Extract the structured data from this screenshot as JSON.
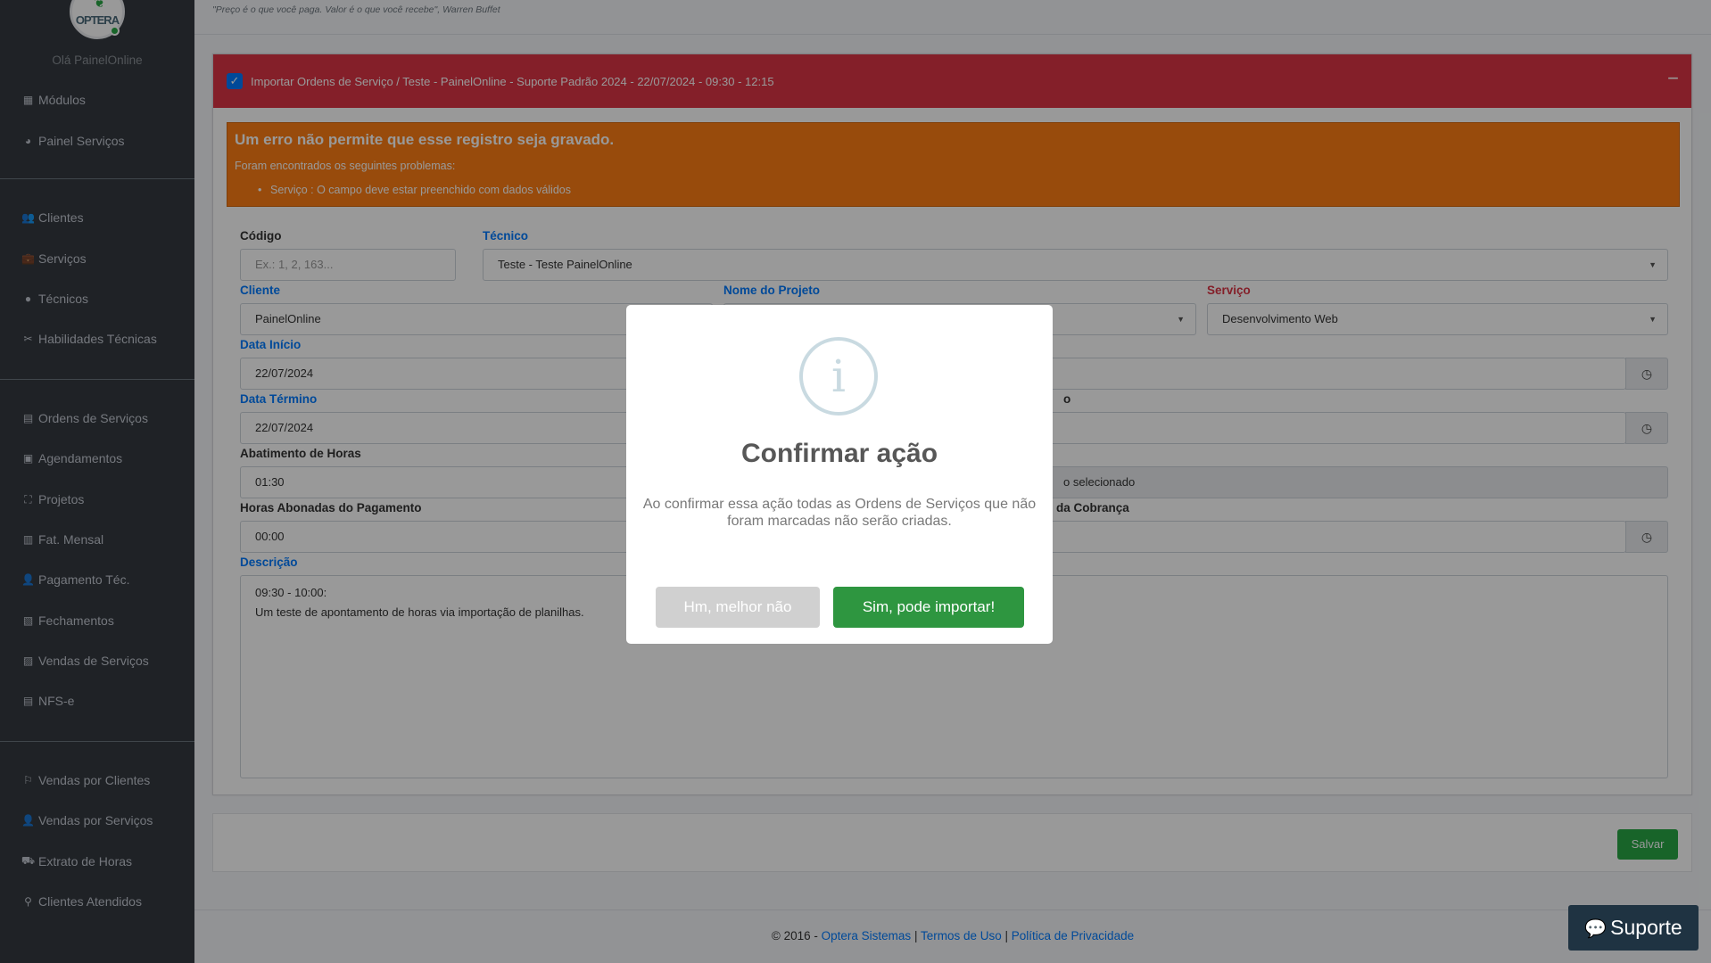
{
  "sidebar": {
    "greeting": "Olá PainelOnline",
    "logo_text": "OPTERA",
    "groups": [
      [
        {
          "label": "Módulos",
          "icon": "▦"
        },
        {
          "label": "Painel Serviços",
          "icon": "◕"
        }
      ],
      [
        {
          "label": "Clientes",
          "icon": "👥"
        },
        {
          "label": "Serviços",
          "icon": "💼"
        },
        {
          "label": "Técnicos",
          "icon": "●"
        },
        {
          "label": "Habilidades Técnicas",
          "icon": "✂"
        }
      ],
      [
        {
          "label": "Ordens de Serviços",
          "icon": "▤"
        },
        {
          "label": "Agendamentos",
          "icon": "▣"
        },
        {
          "label": "Projetos",
          "icon": "⛶"
        },
        {
          "label": "Fat. Mensal",
          "icon": "▥"
        },
        {
          "label": "Pagamento Téc.",
          "icon": "👤"
        },
        {
          "label": "Fechamentos",
          "icon": "▧"
        },
        {
          "label": "Vendas de Serviços",
          "icon": "▨"
        },
        {
          "label": "NFS-e",
          "icon": "▤"
        }
      ],
      [
        {
          "label": "Vendas por Clientes",
          "icon": "⚐"
        },
        {
          "label": "Vendas por Serviços",
          "icon": "👤"
        },
        {
          "label": "Extrato de Horas",
          "icon": "⛟"
        },
        {
          "label": "Clientes Atendidos",
          "icon": "⚲"
        }
      ]
    ]
  },
  "header": {
    "quote": "\"Preço é o que você paga. Valor é o que você recebe\", Warren Buffet"
  },
  "card": {
    "title": "Importar Ordens de Serviço / Teste - PainelOnline - Suporte Padrão 2024 - 22/07/2024 - 09:30 - 12:15",
    "alert": {
      "heading": "Um erro não permite que esse registro seja gravado.",
      "text": "Foram encontrados os seguintes problemas:",
      "items": [
        "Serviço : O campo deve estar preenchido com dados válidos"
      ]
    },
    "form": {
      "codigo_label": "Código",
      "codigo_placeholder": "Ex.: 1, 2, 163...",
      "tecnico_label": "Técnico",
      "tecnico_value": "Teste - Teste PainelOnline",
      "cliente_label": "Cliente",
      "cliente_value": "PainelOnline",
      "projeto_label": "Nome do Projeto",
      "servico_label": "Serviço",
      "servico_value": "Desenvolvimento Web",
      "data_inicio_label": "Data Início",
      "data_inicio_value": "22/07/2024",
      "data_termino_label": "Data Término",
      "data_termino_value": "22/07/2024",
      "abatimento_label": "Abatimento de Horas",
      "abatimento_value": "01:30",
      "right_row_value": "o selecionado",
      "horas_abonadas_label": "Horas Abonadas do Pagamento",
      "horas_abonadas_value": "00:00",
      "right_label_partial": "da Cobrança",
      "right_label_partial2": "o",
      "descricao_label": "Descrição",
      "descricao_line1": "09:30 - 10:00:",
      "descricao_line2": "Um teste de apontamento de horas via importação de planilhas."
    }
  },
  "save_label": "Salvar",
  "footer": {
    "copy": "© 2016 - ",
    "link1": "Optera Sistemas",
    "sep": " | ",
    "link2": "Termos de Uso",
    "link3": "Política de Privacidade"
  },
  "modal": {
    "icon_glyph": "i",
    "title": "Confirmar ação",
    "message": "Ao confirmar essa ação todas as Ordens de Serviços que não foram marcadas não serão criadas.",
    "cancel_label": "Hm, melhor não",
    "confirm_label": "Sim, pode importar!"
  },
  "support": {
    "label": "Suporte",
    "icon": "💬"
  }
}
